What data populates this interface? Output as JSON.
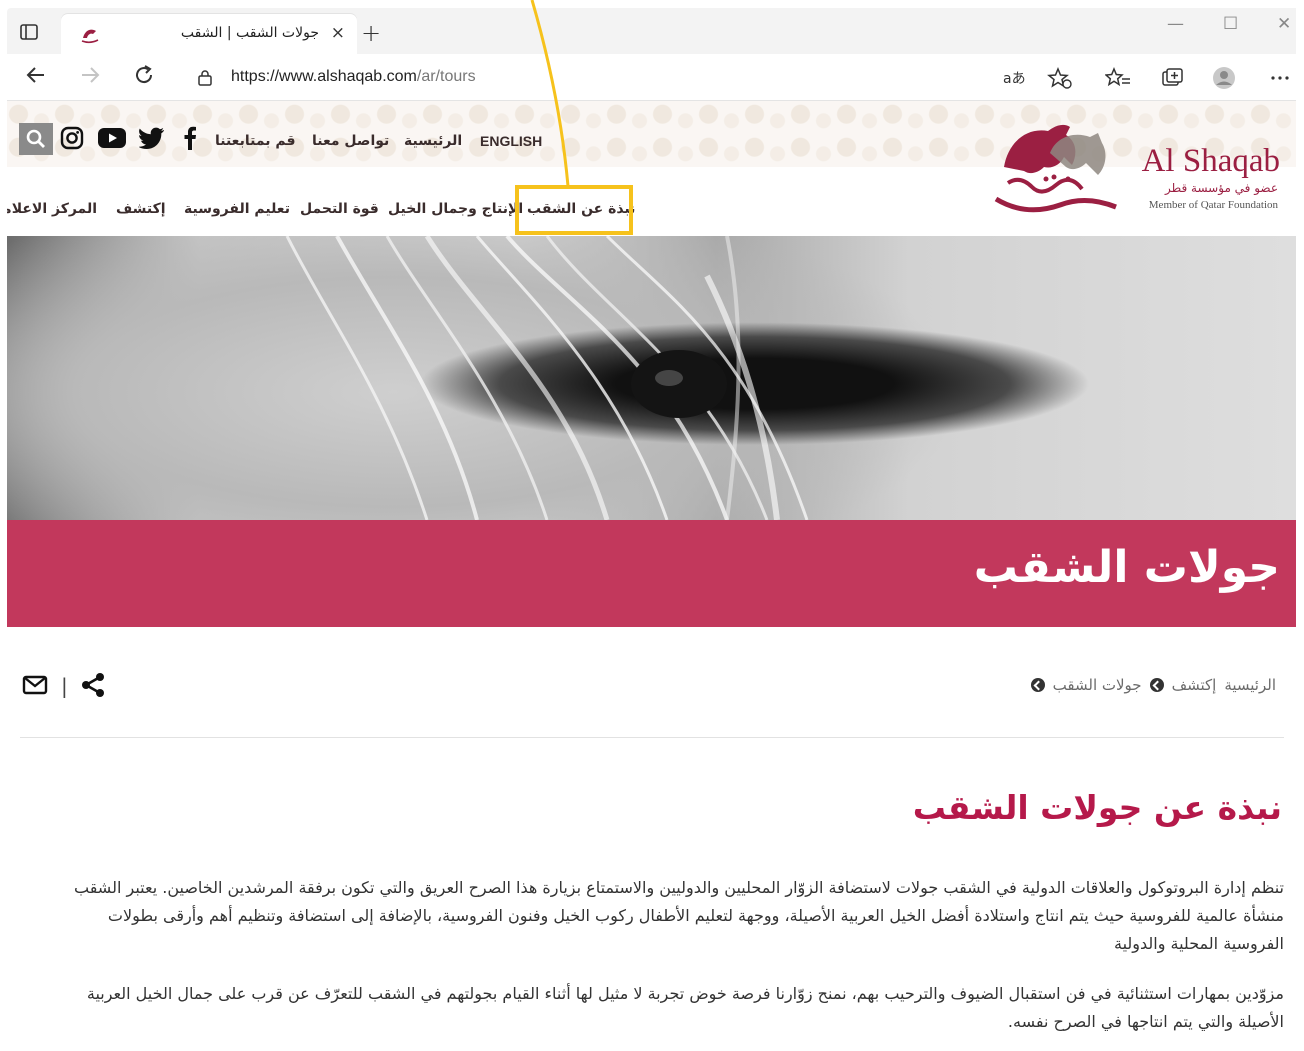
{
  "browser": {
    "tab_title": "جولات الشقب | الشقب",
    "tab_close": "×",
    "new_tab": "+",
    "url_host": "https://www.alshaqab.com",
    "url_path": "/ar/tours",
    "window_minimize": "—",
    "window_maximize": "☐",
    "window_close": "✕"
  },
  "site": {
    "logo_en": "Al Shaqab",
    "logo_ar": "عضو في مؤسسة قطر",
    "logo_member": "Member of Qatar Foundation",
    "top_links": {
      "english": "ENGLISH",
      "home": "الرئيسية",
      "contact": "تواصل معنا",
      "follow": "قم بمتابعتنا"
    },
    "main_nav": [
      "نبذة عن الشقب",
      "الإنتاج وجمال الخيل",
      "قوة التحمل",
      "تعليم الفروسية",
      "إكتشف",
      "المركز الاعلامي"
    ]
  },
  "banner": {
    "title": "جولات الشقب"
  },
  "breadcrumb": {
    "home": "الرئيسية",
    "discover": "إكتشف",
    "current": "جولات الشقب"
  },
  "tools": {
    "separator": "|"
  },
  "content": {
    "title": "نبذة عن جولات الشقب",
    "paragraph1": "تنظم إدارة البروتوكول والعلاقات الدولية في الشقب جولات لاستضافة الزوّار المحليين والدوليين والاستمتاع بزيارة هذا الصرح العريق والتي تكون برفقة المرشدين الخاصين. يعتبر الشقب منشأة عالمية للفروسية حيث يتم انتاج واستلادة أفضل الخيل العربية الأصيلة، ووجهة لتعليم الأطفال ركوب الخيل وفنون الفروسية، بالإضافة إلى استضافة وتنظيم أهم وأرقى بطولات الفروسية المحلية والدولية",
    "paragraph2": "مزوّدين بمهارات استثنائية في فن استقبال الضيوف والترحيب بهم، نمنح زوّارنا فرصة خوض تجربة لا مثيل لها أثناء القيام بجولتهم في الشقب للتعرّف عن قرب على جمال الخيل العربية الأصيلة والتي يتم انتاجها في الصرح نفسه."
  },
  "colors": {
    "brand": "#9b1f42",
    "banner": "#c2385c",
    "highlight": "#f6c21c"
  }
}
